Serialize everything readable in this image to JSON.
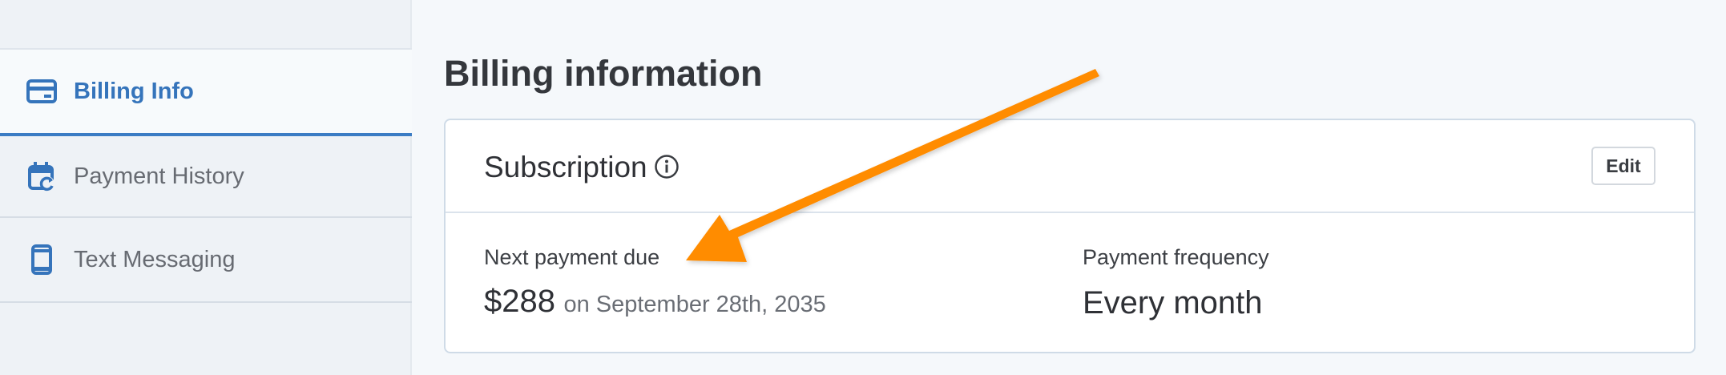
{
  "sidebar": {
    "items": [
      {
        "label": "Billing Info",
        "icon": "credit-card-icon",
        "active": true
      },
      {
        "label": "Payment History",
        "icon": "calendar-refresh-icon",
        "active": false
      },
      {
        "label": "Text Messaging",
        "icon": "phone-icon",
        "active": false
      }
    ]
  },
  "main": {
    "title": "Billing information",
    "card": {
      "title": "Subscription",
      "edit_label": "Edit",
      "next_payment": {
        "label": "Next payment due",
        "amount": "$288",
        "date": "on September 28th, 2035"
      },
      "frequency": {
        "label": "Payment frequency",
        "value": "Every month"
      }
    }
  },
  "colors": {
    "accent": "#3574bb",
    "annotation_arrow": "#ff8c00"
  }
}
